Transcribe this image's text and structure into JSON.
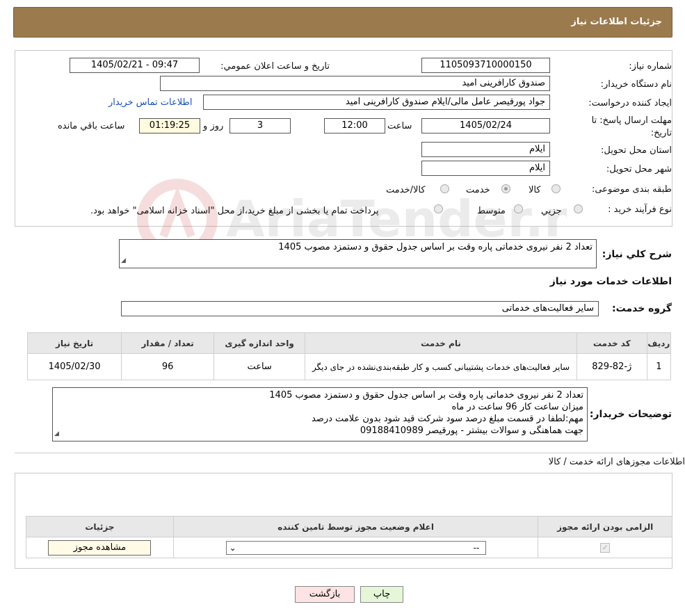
{
  "header": {
    "title": "جزئیات اطلاعات نیاز"
  },
  "need": {
    "number_label": "شماره نیاز:",
    "number": "1105093710000150",
    "announce_label": "تاریخ و ساعت اعلان عمومي:",
    "announce_value": "1405/02/21 - 09:47",
    "buyer_label": "نام دستگاه خریدار:",
    "buyer": "صندوق کارافرینی امید",
    "creator_label": "ایجاد کننده درخواست:",
    "creator": "جواد پورقیصر عامل مالی/ایلام صندوق کارافرینی امید",
    "contact_link": "اطلاعات تماس خریدار",
    "deadline_label": "مهلت ارسال پاسخ: تا تاریخ:",
    "deadline_date": "1405/02/24",
    "time_label": "ساعت",
    "deadline_time": "12:00",
    "days": "3",
    "days_label": "روز و",
    "remaining": "01:19:25",
    "remaining_label": "ساعت باقي مانده",
    "province_label": "استان محل تحویل:",
    "province": "ایلام",
    "city_label": "شهر محل تحویل:",
    "city": "ایلام",
    "category_label": "طبقه بندی موضوعی:",
    "category_options": [
      "کالا",
      "خدمت",
      "کالا/خدمت"
    ],
    "category_selected": "خدمت",
    "purchase_label": "نوع فرآیند خرید :",
    "purchase_options": [
      "جزیي",
      "متوسط"
    ],
    "purchase_note": "پرداخت تمام یا بخشی از مبلغ خرید،از محل \"اسناد خزانه اسلامی\" خواهد بود.",
    "summary_label": "شرح کلي نياز:",
    "summary": "تعداد 2 نفر نیروی خدماتی پاره وقت بر اساس جدول حقوق و دستمزد مصوب 1405"
  },
  "services": {
    "section_title": "اطلاعات خدمات مورد نیاز",
    "group_label": "گروه خدمت:",
    "group": "سایر فعالیت‌های خدماتی",
    "table": {
      "headers": [
        "ردیف",
        "کد خدمت",
        "نام خدمت",
        "واحد اندازه گیری",
        "تعداد / مقدار",
        "تاریخ نیاز"
      ],
      "rows": [
        [
          "1",
          "ژ-82-829",
          "سایر فعالیت‌های خدمات پشتیبانی کسب و کار طبقه‌بندی‌نشده در جای دیگر",
          "ساعت",
          "96",
          "1405/02/30"
        ]
      ]
    },
    "buyer_notes_label": "توضیحات خریدار:",
    "buyer_notes": [
      "تعداد 2 نفر نیروی خدماتی پاره وقت بر اساس جدول حقوق و دستمزد مصوب 1405",
      "میزان ساعت کار 96 ساعت در ماه",
      "مهم:لطفا در قسمت مبلغ درصد سود شرکت قید شود بدون علامت درصد",
      "جهت هماهنگی و سوالات بیشتر - پورقیصر 09188410989"
    ]
  },
  "permits": {
    "section_title": "اطلاعات مجوزهای ارائه خدمت / کالا",
    "headers": [
      "الزامی بودن ارائه مجوز",
      "اعلام وضعیت مجوز توسط تامین کننده",
      "جزئیات"
    ],
    "select_value": "--",
    "view_button": "مشاهده مجوز"
  },
  "actions": {
    "print": "چاپ",
    "back": "بازگشت"
  },
  "watermark": {
    "text": "AriaTender.neT"
  },
  "colors": {
    "header_bg": "#9b7a4e",
    "link": "#1a4fb5",
    "back_bg": "#fde3e3",
    "print_bg": "#e6f7d9"
  }
}
